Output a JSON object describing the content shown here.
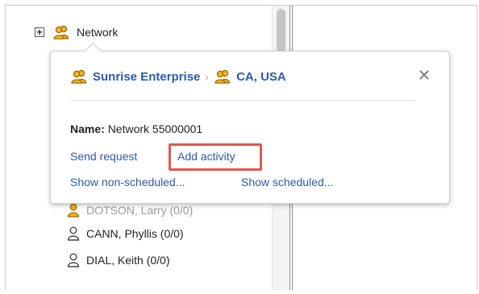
{
  "tree": {
    "network_row": {
      "expander": "+",
      "label": "Network"
    },
    "hidden_row": {
      "label": "DOTSON, Larry (0/0)"
    },
    "people": [
      {
        "label": "CANN, Phyllis (0/0)"
      },
      {
        "label": "DIAL, Keith (0/0)"
      }
    ]
  },
  "popover": {
    "breadcrumb": [
      {
        "label": "Sunrise Enterprise"
      },
      {
        "label": "CA, USA"
      }
    ],
    "breadcrumb_separator": "›",
    "name_label": "Name:",
    "name_value": "Network 55000001",
    "actions": {
      "send_request": "Send request",
      "add_activity": "Add activity",
      "show_non_scheduled": "Show non-scheduled...",
      "show_scheduled": "Show scheduled..."
    },
    "close_icon": "close-icon"
  },
  "colors": {
    "link": "#2d5aa8",
    "highlight": "#e2574c",
    "group_icon_fill": "#f3b21d",
    "group_icon_stroke": "#9a6a00"
  }
}
